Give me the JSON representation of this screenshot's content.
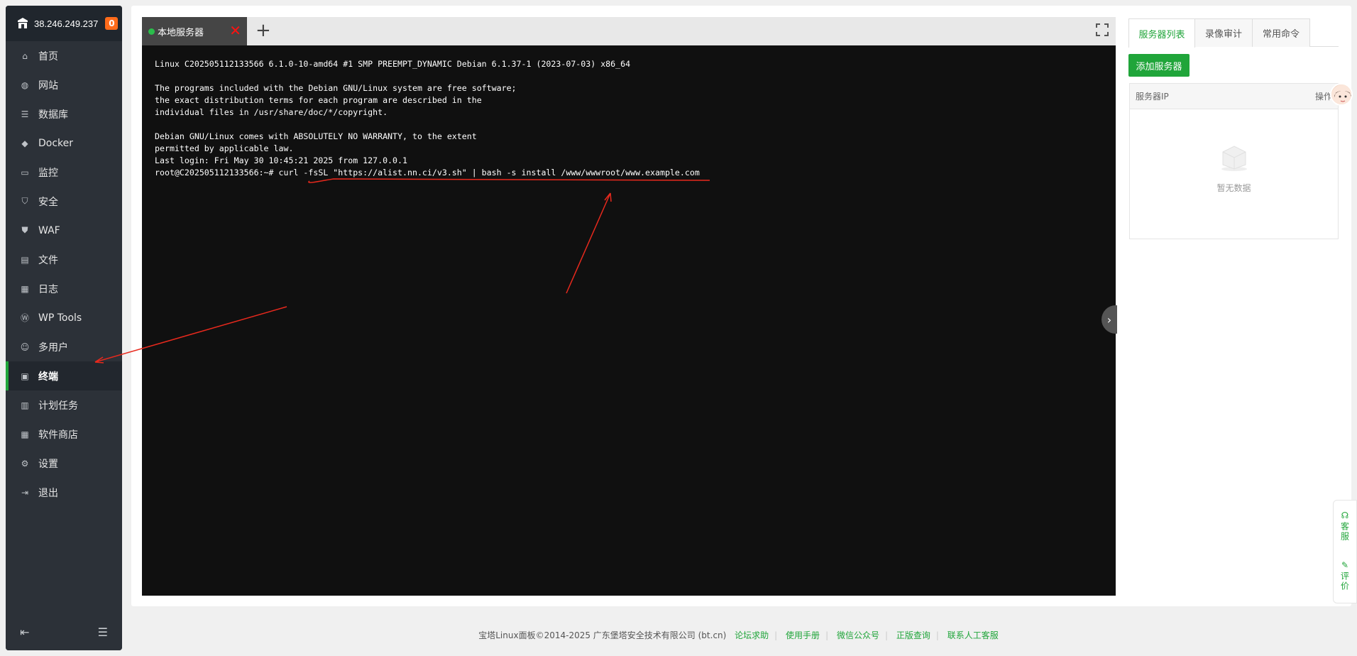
{
  "sidebar": {
    "ip": "38.246.249.237",
    "badge": "0",
    "items": [
      {
        "label": "首页",
        "icon": "home-icon"
      },
      {
        "label": "网站",
        "icon": "globe-icon"
      },
      {
        "label": "数据库",
        "icon": "database-icon"
      },
      {
        "label": "Docker",
        "icon": "docker-icon"
      },
      {
        "label": "监控",
        "icon": "monitor-icon"
      },
      {
        "label": "安全",
        "icon": "shield-icon"
      },
      {
        "label": "WAF",
        "icon": "waf-icon"
      },
      {
        "label": "文件",
        "icon": "folder-icon"
      },
      {
        "label": "日志",
        "icon": "log-icon"
      },
      {
        "label": "WP Tools",
        "icon": "wordpress-icon"
      },
      {
        "label": "多用户",
        "icon": "users-icon"
      },
      {
        "label": "终端",
        "icon": "terminal-icon"
      },
      {
        "label": "计划任务",
        "icon": "calendar-icon"
      },
      {
        "label": "软件商店",
        "icon": "apps-icon"
      },
      {
        "label": "设置",
        "icon": "gear-icon"
      },
      {
        "label": "退出",
        "icon": "logout-icon"
      }
    ],
    "active_item": "终端"
  },
  "terminal": {
    "tab_label": "本地服务器",
    "lines": [
      "Linux C202505112133566 6.1.0-10-amd64 #1 SMP PREEMPT_DYNAMIC Debian 6.1.37-1 (2023-07-03) x86_64",
      "",
      "The programs included with the Debian GNU/Linux system are free software;",
      "the exact distribution terms for each program are described in the",
      "individual files in /usr/share/doc/*/copyright.",
      "",
      "Debian GNU/Linux comes with ABSOLUTELY NO WARRANTY, to the extent",
      "permitted by applicable law.",
      "Last login: Fri May 30 10:45:21 2025 from 127.0.0.1",
      "root@C202505112133566:~# curl -fsSL \"https://alist.nn.ci/v3.sh\" | bash -s install /www/wwwroot/www.example.com"
    ]
  },
  "right_panel": {
    "tabs": [
      "服务器列表",
      "录像审计",
      "常用命令"
    ],
    "active_tab": "服务器列表",
    "add_button": "添加服务器",
    "table_header_ip": "服务器IP",
    "table_header_op": "操作",
    "empty_text": "暂无数据"
  },
  "float": {
    "service": "客服",
    "review": "评价"
  },
  "footer": {
    "copyright": "宝塔Linux面板©2014-2025 广东堡塔安全技术有限公司 (bt.cn)",
    "links": [
      "论坛求助",
      "使用手册",
      "微信公众号",
      "正版查询",
      "联系人工客服"
    ]
  },
  "colors": {
    "accent": "#20a53a",
    "sidebar_bg": "#2c3138",
    "terminal_bg": "#101010",
    "annotation": "#e8291d"
  }
}
